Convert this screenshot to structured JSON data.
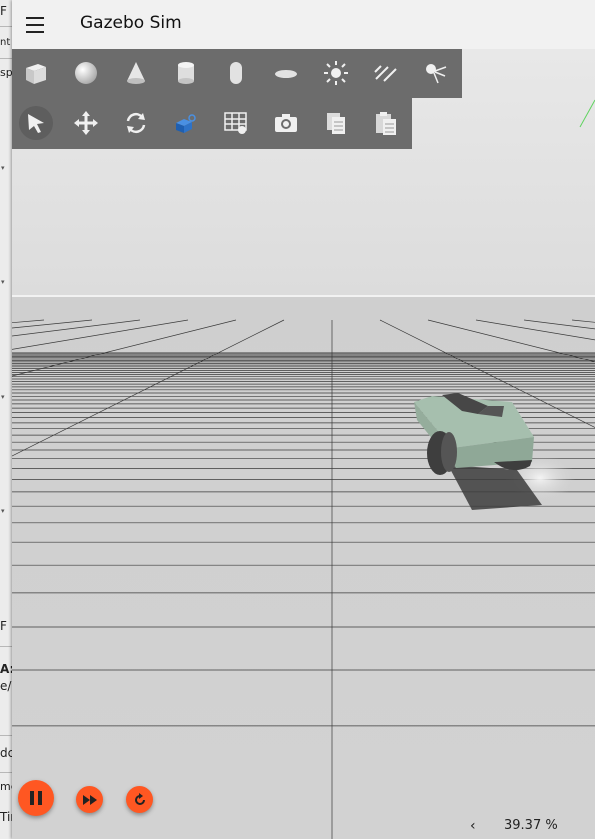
{
  "background_window": {
    "fragments": [
      "F",
      "nt",
      "sp",
      "F",
      "A:",
      "e/(",
      "dc",
      "me",
      "Tir"
    ]
  },
  "window": {
    "title": "Gazebo Sim"
  },
  "menu_icon": "hamburger-menu-icon",
  "shapes_toolbar": {
    "items": [
      "box-icon",
      "sphere-icon",
      "cone-icon",
      "cylinder-icon",
      "capsule-icon",
      "ellipsoid-icon",
      "point-light-icon",
      "directional-light-icon",
      "spot-light-icon"
    ]
  },
  "transform_toolbar": {
    "items": [
      "select-mode-icon",
      "translate-mode-icon",
      "rotate-mode-icon",
      "view-angle-icon",
      "grid-config-icon",
      "screenshot-icon",
      "copy-icon",
      "paste-icon"
    ],
    "active": "select-mode-icon"
  },
  "playback": {
    "play_state": "playing",
    "pause_icon": "pause-icon",
    "step_icon": "step-forward-icon",
    "reset_icon": "reset-icon"
  },
  "stats": {
    "rtf_toggle_icon": "chevron-left-icon",
    "real_time_factor": "39.37 %"
  },
  "colors": {
    "accent": "#ff5722",
    "toolbar": "#6c6c6c",
    "titlebar": "#f1f1f1",
    "sky": "#e3e3e3",
    "ground": "#d0d0d0",
    "vehicle_body": "#a6bfae"
  }
}
